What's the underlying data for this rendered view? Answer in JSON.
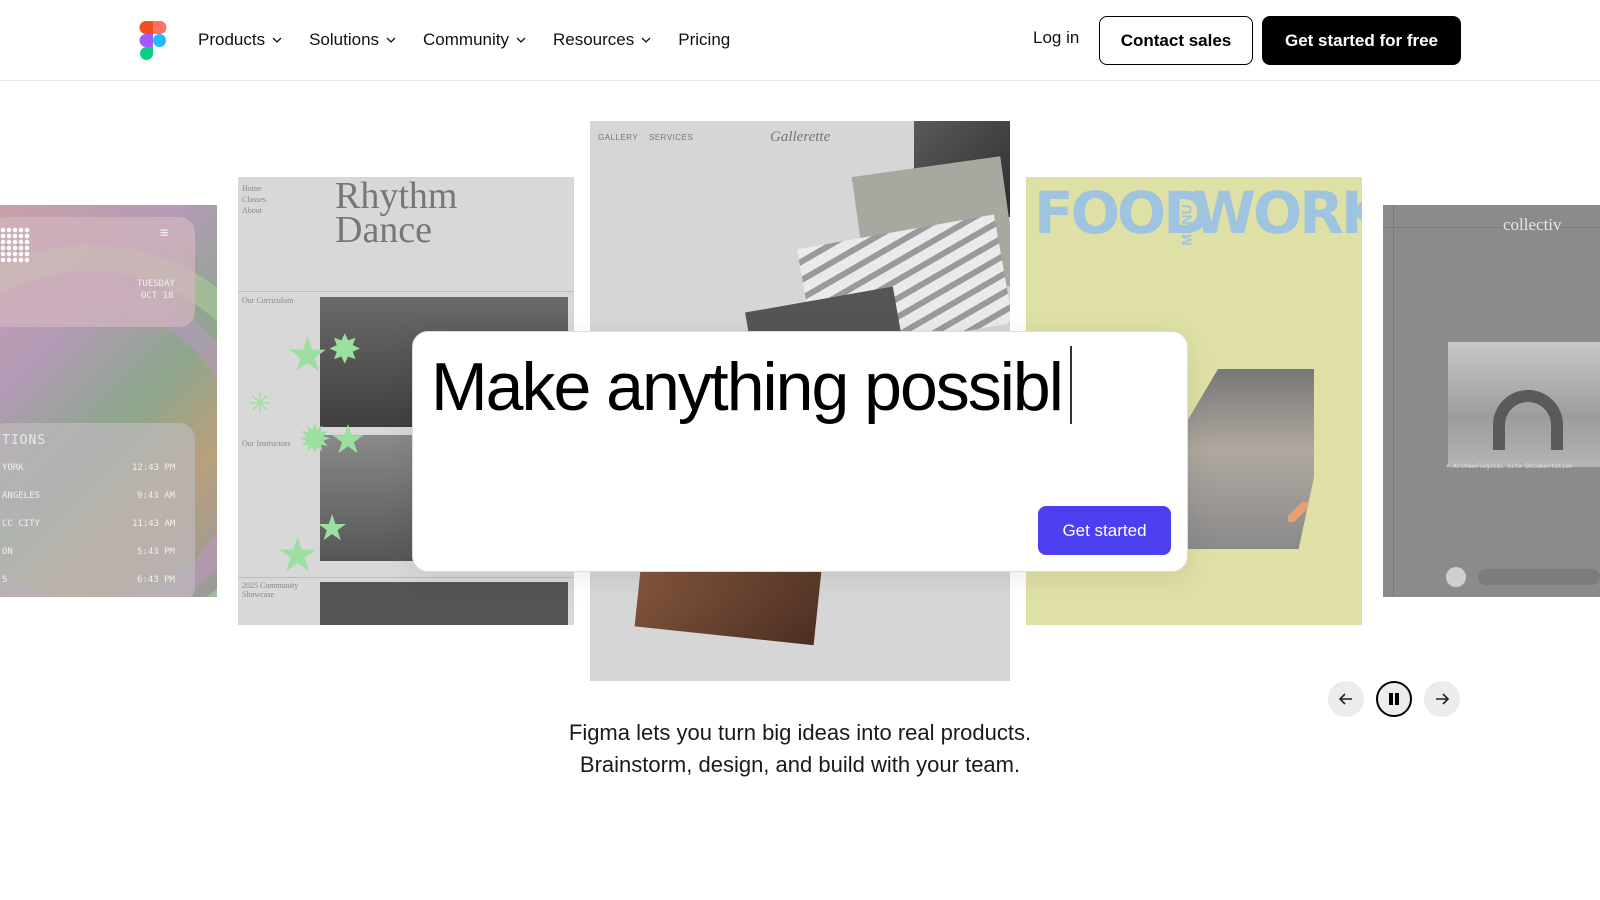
{
  "header": {
    "nav": [
      {
        "label": "Products",
        "has_dropdown": true
      },
      {
        "label": "Solutions",
        "has_dropdown": true
      },
      {
        "label": "Community",
        "has_dropdown": true
      },
      {
        "label": "Resources",
        "has_dropdown": true
      },
      {
        "label": "Pricing",
        "has_dropdown": false
      }
    ],
    "login_label": "Log in",
    "contact_label": "Contact sales",
    "cta_label": "Get started for free"
  },
  "cards": {
    "clock": {
      "day": "TUESDAY",
      "date": "OCT 18",
      "section": "TIONS",
      "rows": [
        {
          "city": "YORK",
          "time": "12:43 PM"
        },
        {
          "city": "ANGELES",
          "time": "9:43 AM"
        },
        {
          "city": "CC CITY",
          "time": "11:43 AM"
        },
        {
          "city": "ON",
          "time": "5:43 PM"
        },
        {
          "city": "S",
          "time": "6:43 PM"
        }
      ]
    },
    "dance": {
      "title": "Rhythm Dance",
      "nav": [
        "Home",
        "Classes",
        "About"
      ],
      "sections": [
        "Our Curriculum",
        "Our Instructors",
        "2025 Community Showcase"
      ]
    },
    "gallery": {
      "nav": "GALLERY    SERVICES",
      "brand": "Gallerette"
    },
    "food": {
      "word1": "FOOD",
      "word2": "WORKS",
      "menu": "MENU"
    },
    "collectiv": {
      "brand": "collectiv",
      "caption": "+ Archaeological Site Documentation"
    }
  },
  "prompt": {
    "text": "Make anything possibl",
    "button_label": "Get started"
  },
  "carousel": {
    "state": "playing"
  },
  "tagline": {
    "line1": "Figma lets you turn big ideas into real products.",
    "line2": "Brainstorm, design, and build with your team."
  },
  "colors": {
    "primary_button": "#4c3ff0",
    "cta_background": "#000000"
  }
}
